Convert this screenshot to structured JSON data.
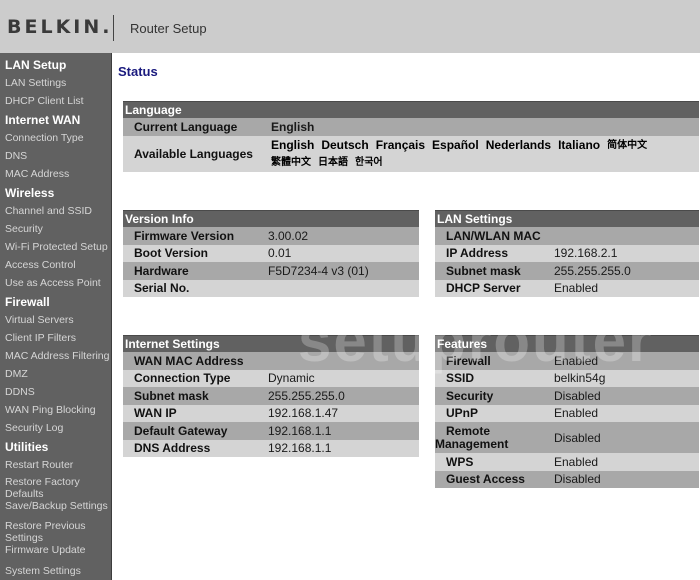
{
  "header": {
    "logo": "BELKIN.",
    "title": "Router Setup"
  },
  "sidebar": {
    "sections": [
      {
        "title": "LAN Setup",
        "items": [
          "LAN Settings",
          "DHCP Client List"
        ]
      },
      {
        "title": "Internet WAN",
        "items": [
          "Connection Type",
          "DNS",
          "MAC Address"
        ]
      },
      {
        "title": "Wireless",
        "items": [
          "Channel and SSID",
          "Security",
          "Wi-Fi Protected Setup",
          "Access Control",
          "Use as Access Point"
        ]
      },
      {
        "title": "Firewall",
        "items": [
          "Virtual Servers",
          "Client IP Filters",
          "MAC Address Filtering",
          "DMZ",
          "DDNS",
          "WAN Ping Blocking",
          "Security Log"
        ]
      },
      {
        "title": "Utilities",
        "items": [
          "Restart Router",
          "Restore Factory Defaults",
          "Save/Backup Settings",
          "Restore Previous Settings",
          "Firmware Update",
          "System Settings"
        ]
      }
    ]
  },
  "main": {
    "page_title": "Status",
    "language": {
      "header": "Language",
      "current_label": "Current Language",
      "current_value": "English",
      "available_label": "Available Languages",
      "available": [
        "English",
        "Deutsch",
        "Français",
        "Español",
        "Nederlands",
        "Italiano",
        "简体中文",
        "繁體中文",
        "日本語",
        "한국어"
      ]
    },
    "version_info": {
      "header": "Version Info",
      "rows": [
        {
          "label": "Firmware Version",
          "value": "3.00.02"
        },
        {
          "label": "Boot Version",
          "value": "0.01"
        },
        {
          "label": "Hardware",
          "value": "F5D7234-4 v3 (01)"
        },
        {
          "label": "Serial No.",
          "value": ""
        }
      ]
    },
    "lan_settings": {
      "header": "LAN Settings",
      "rows": [
        {
          "label": "LAN/WLAN MAC",
          "value": ""
        },
        {
          "label": "IP Address",
          "value": "192.168.2.1"
        },
        {
          "label": "Subnet mask",
          "value": "255.255.255.0"
        },
        {
          "label": "DHCP Server",
          "value": "Enabled"
        }
      ]
    },
    "internet_settings": {
      "header": "Internet Settings",
      "rows": [
        {
          "label": "WAN MAC Address",
          "value": ""
        },
        {
          "label": "Connection Type",
          "value": "Dynamic"
        },
        {
          "label": "Subnet mask",
          "value": "255.255.255.0"
        },
        {
          "label": "WAN IP",
          "value": "192.168.1.47"
        },
        {
          "label": "Default Gateway",
          "value": "192.168.1.1"
        },
        {
          "label": "DNS Address",
          "value": "192.168.1.1"
        }
      ]
    },
    "features": {
      "header": "Features",
      "rows": [
        {
          "label": "Firewall",
          "value": "Enabled"
        },
        {
          "label": "SSID",
          "value": "belkin54g"
        },
        {
          "label": "Security",
          "value": "Disabled"
        },
        {
          "label": "UPnP",
          "value": "Enabled"
        },
        {
          "label": "Remote Management",
          "value": "Disabled"
        },
        {
          "label": "WPS",
          "value": "Enabled"
        },
        {
          "label": "Guest Access",
          "value": "Disabled"
        }
      ]
    },
    "watermark": "setuprouter"
  }
}
